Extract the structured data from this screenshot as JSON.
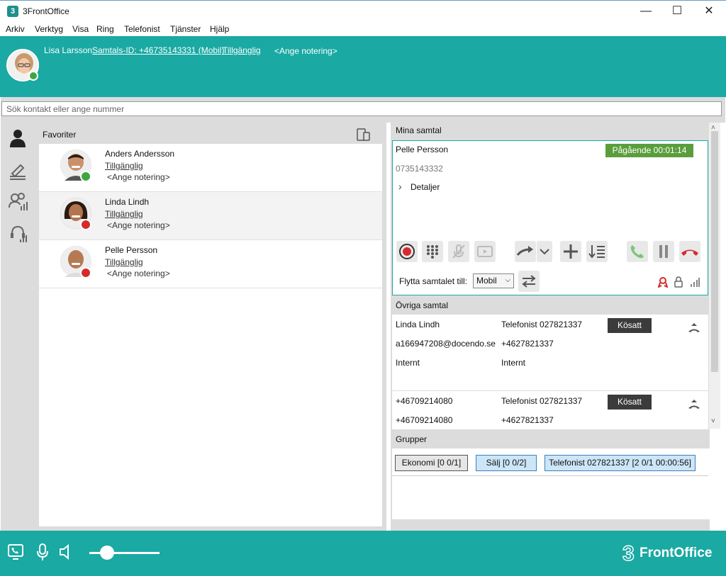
{
  "window": {
    "title": "3FrontOffice",
    "app_icon": "3"
  },
  "menu": [
    "Arkiv",
    "Verktyg",
    "Visa",
    "Ring",
    "Telefonist",
    "Tjänster",
    "Hjälp"
  ],
  "header": {
    "user_name": "Lisa Larsson",
    "call_id": "Samtals-ID: +46735143331 (Mobil)",
    "status": "Tillgänglig",
    "note": "<Ange notering>"
  },
  "search": {
    "placeholder": "Sök kontakt eller ange nummer"
  },
  "favorites": {
    "title": "Favoriter",
    "contacts": [
      {
        "name": "Anders Andersson",
        "status": "Tillgänglig",
        "note": "<Ange notering>",
        "presence": "available"
      },
      {
        "name": "Linda Lindh",
        "status": "Tillgänglig",
        "note": "<Ange notering>",
        "presence": "in-call"
      },
      {
        "name": "Pelle Persson",
        "status": "Tillgänglig",
        "note": "<Ange notering>",
        "presence": "in-call"
      }
    ]
  },
  "my_calls": {
    "title": "Mina samtal",
    "caller": "Pelle Persson",
    "number": "0735143332",
    "status_badge": "Pågående 00:01:14",
    "details": "Detaljer",
    "move_label": "Flytta samtalet till:",
    "move_value": "Mobil"
  },
  "other_calls": {
    "title": "Övriga samtal",
    "calls": [
      {
        "from": "Linda Lindh",
        "from_sub": "a166947208@docendo.se",
        "from_type": "Internt",
        "to": "Telefonist 027821337",
        "to_sub": "+4627821337",
        "to_type": "Internt",
        "badge": "Kösatt"
      },
      {
        "from": "+46709214080",
        "from_sub": "+46709214080",
        "to": "Telefonist 027821337",
        "to_sub": "+4627821337",
        "badge": "Kösatt"
      }
    ]
  },
  "groups": {
    "title": "Grupper",
    "items": [
      {
        "label": "Ekonomi [0 0/1]"
      },
      {
        "label": "Sälj [0 0/2]"
      },
      {
        "label": "Telefonist 027821337 [2 0/1  00:00:56]"
      }
    ]
  },
  "footer": {
    "logo_text": "FrontOffice",
    "logo_digit": "3",
    "volume_level": 0.25
  },
  "colors": {
    "accent": "#1aa9a3",
    "badge_green": "#5a9e3c",
    "hangup_red": "#d62b2b"
  }
}
